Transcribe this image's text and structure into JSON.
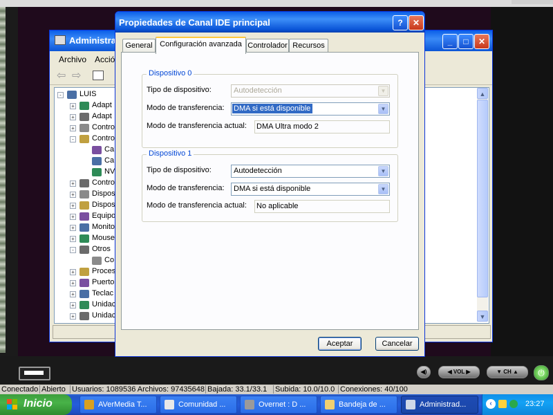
{
  "dialog": {
    "title": "Propiedades de Canal IDE principal",
    "tabs": [
      "General",
      "Configuración avanzada",
      "Controlador",
      "Recursos"
    ],
    "active_tab": "Configuración avanzada",
    "device0": {
      "legend": "Dispositivo 0",
      "type_label": "Tipo de dispositivo:",
      "type_value": "Autodetección",
      "mode_label": "Modo de transferencia:",
      "mode_value": "DMA si está disponible",
      "current_label": "Modo de transferencia actual:",
      "current_value": "DMA Ultra modo 2"
    },
    "device1": {
      "legend": "Dispositivo 1",
      "type_label": "Tipo de dispositivo:",
      "type_value": "Autodetección",
      "mode_label": "Modo de transferencia:",
      "mode_value": "DMA si está disponible",
      "current_label": "Modo de transferencia actual:",
      "current_value": "No aplicable"
    },
    "accept_label": "Aceptar",
    "cancel_label": "Cancelar",
    "help_glyph": "?",
    "close_glyph": "✕"
  },
  "background_window": {
    "title": "Administra",
    "menu": [
      "Archivo",
      "Acció"
    ],
    "tree": [
      {
        "label": "LUIS",
        "depth": 0,
        "expander": "-"
      },
      {
        "label": "Adapt",
        "depth": 1,
        "expander": "+"
      },
      {
        "label": "Adapt",
        "depth": 1,
        "expander": "+"
      },
      {
        "label": "Contro",
        "depth": 1,
        "expander": "+"
      },
      {
        "label": "Contro",
        "depth": 1,
        "expander": "-"
      },
      {
        "label": "Ca",
        "depth": 2,
        "expander": ""
      },
      {
        "label": "Ca",
        "depth": 2,
        "expander": ""
      },
      {
        "label": "NV",
        "depth": 2,
        "expander": ""
      },
      {
        "label": "Contro",
        "depth": 1,
        "expander": "+"
      },
      {
        "label": "Dispos",
        "depth": 1,
        "expander": "+"
      },
      {
        "label": "Dispos",
        "depth": 1,
        "expander": "+"
      },
      {
        "label": "Equipo",
        "depth": 1,
        "expander": "+"
      },
      {
        "label": "Monito",
        "depth": 1,
        "expander": "+"
      },
      {
        "label": "Mouse",
        "depth": 1,
        "expander": "+"
      },
      {
        "label": "Otros",
        "depth": 1,
        "expander": "-"
      },
      {
        "label": "Co",
        "depth": 2,
        "expander": ""
      },
      {
        "label": "Proces",
        "depth": 1,
        "expander": "+"
      },
      {
        "label": "Puerto",
        "depth": 1,
        "expander": "+"
      },
      {
        "label": "Teclac",
        "depth": 1,
        "expander": "+"
      },
      {
        "label": "Unidac",
        "depth": 1,
        "expander": "+"
      },
      {
        "label": "Unidac",
        "depth": 1,
        "expander": "+"
      }
    ]
  },
  "viewer": {
    "vol_label": "VOL",
    "ch_label": "CH"
  },
  "status_line": {
    "items": [
      "Conectado",
      "Abierto",
      "Usuarios: 1089536 Archivos: 97435648",
      "Bajada: 33.1/33.1",
      "Subida: 10.0/10.0",
      "Conexiones: 40/100"
    ]
  },
  "taskbar": {
    "start_label": "Inicio",
    "tasks": [
      {
        "label": "AVerMedia T...",
        "icon_color": "#d8a020",
        "active": false
      },
      {
        "label": "Comunidad ...",
        "icon_color": "#e8e8e8",
        "active": false
      },
      {
        "label": "Overnet : D ...",
        "icon_color": "#9a9a9a",
        "active": false
      },
      {
        "label": "Bandeja de ...",
        "icon_color": "#f0d070",
        "active": false
      },
      {
        "label": "Administrad...",
        "icon_color": "#cfd8e8",
        "active": true
      }
    ],
    "clock": "23:27"
  },
  "colors": {
    "xp_blue": "#0a5ee8",
    "selection": "#316ac5",
    "group_legend": "#0046d5",
    "start_green": "#3c9e3c"
  }
}
